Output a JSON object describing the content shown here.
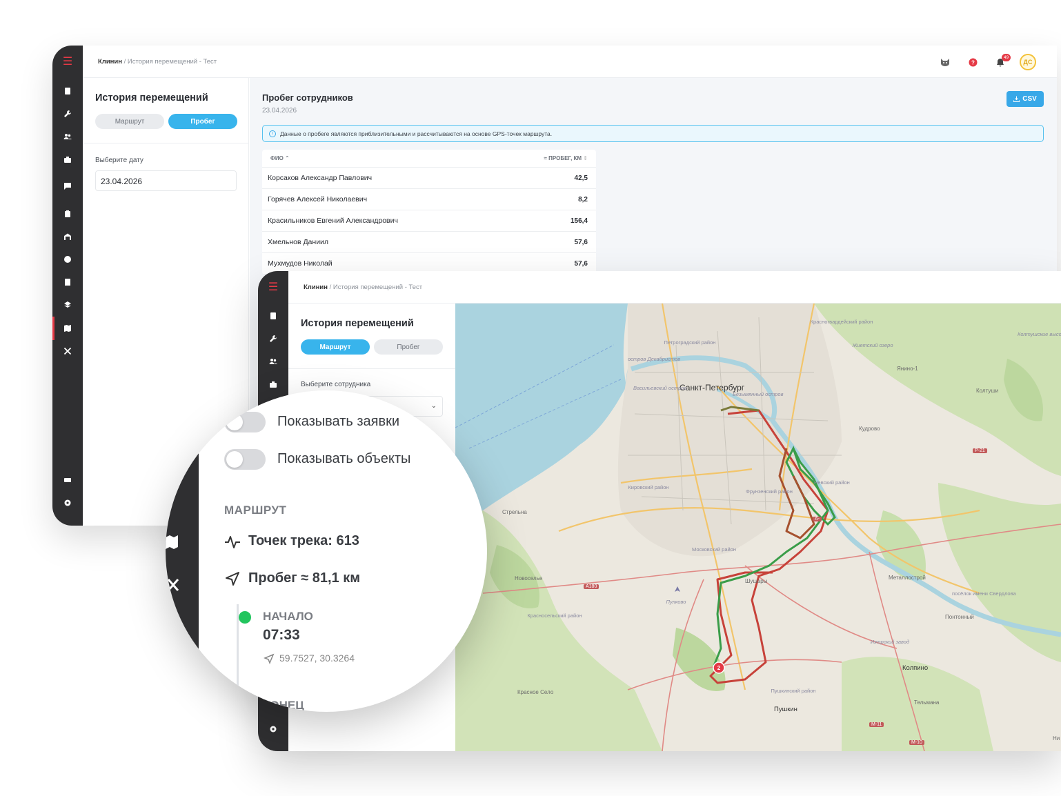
{
  "breadcrumb": {
    "company": "Клинин",
    "separator": "/",
    "page": "История перемещений - Тест"
  },
  "topbar": {
    "notifications_count": "49",
    "avatar_initials": "ДС"
  },
  "sidebar": {
    "items": [
      "list-icon",
      "wrench-icon",
      "users-icon",
      "briefcase-icon",
      "chat-icon",
      "clipboard-icon",
      "warehouse-icon",
      "chart-pie-icon",
      "report-icon",
      "map-layers-icon",
      "map-icon",
      "tools-icon",
      "card-icon",
      "settings-icon"
    ]
  },
  "history": {
    "title": "История перемещений",
    "tab_route": "Маршрут",
    "tab_mileage": "Пробег",
    "date_label": "Выберите дату",
    "date_value": "23.04.2026",
    "employee_label": "Выберите сотрудника"
  },
  "mileage": {
    "title": "Пробег сотрудников",
    "date": "23.04.2026",
    "csv_label": "CSV",
    "info": "Данные о пробеге являются приблизительными и рассчитываются на основе GPS-точек маршрута.",
    "col_name": "ФИО",
    "col_km": "≈ ПРОБЕГ, КМ",
    "rows": [
      {
        "name": "Корсаков Александр Павлович",
        "km": "42,5"
      },
      {
        "name": "Горячев Алексей Николаевич",
        "km": "8,2"
      },
      {
        "name": "Красильников Евгений Александрович",
        "km": "156,4"
      },
      {
        "name": "Хмельнов Даниил",
        "km": "57,6"
      },
      {
        "name": "Мухмудов Николай",
        "km": "57,6"
      }
    ]
  },
  "route_panel": {
    "show_requests": "Показывать заявки",
    "show_objects": "Показывать объекты",
    "section": "МАРШРУТ",
    "track_points": "Точек трека: 613",
    "distance": "Пробег ≈ 81,1 км",
    "start_label": "НАЧАЛО",
    "start_time": "07:33",
    "start_coords": "59.7527, 30.3264",
    "end_label": "КОНЕЦ"
  },
  "map": {
    "labels": {
      "spb": "Санкт-Петербург",
      "petrogradsky": "Петроградский район",
      "krasnogvard": "Красногвардейский район",
      "dekabr": "остров Декабристов",
      "vasil": "Васильевский остров",
      "bezym": "Безымянный остров",
      "kirov": "Кировский район",
      "frunze": "Фрунзенский район",
      "nevsky": "Невский район",
      "moskov": "Московский район",
      "strelna": "Стрельна",
      "novoselie": "Новоселье",
      "krasnosel": "Красносельский район",
      "shushary": "Шушары",
      "metallostroy": "Металлострой",
      "sverdlova": "посёлок имени Свердлова",
      "pontonny": "Понтонный",
      "izhorsky": "Ижорский завод",
      "kolpino": "Колпино",
      "krasnoe_selo": "Красное Село",
      "pushkinsky": "Пушкинский район",
      "pushkin": "Пушкин",
      "telmana": "Тельмана",
      "koltushi": "Колтуши",
      "kudrovo": "Кудрово",
      "yanino": "Янино-1",
      "zhiteskiy": "Жиетский озеро",
      "koltushskie": "Колтушские высоты",
      "pulkovo": "Пулково",
      "r21": "Р-21",
      "a180": "А180",
      "m11": "М-11",
      "m10": "М-10",
      "a": "А-",
      "ni": "Ни"
    },
    "marker": "2",
    "colors": {
      "route_red": "#c7423a",
      "route_green": "#3a9d49",
      "route_olive": "#7a7a3a",
      "water": "#aad3df",
      "land": "#ece8df",
      "green": "#c8dfae"
    }
  },
  "colors": {
    "accent": "#38b4ec",
    "danger": "#e53945",
    "sidebar": "#2f2f31",
    "start_dot": "#22c55e"
  }
}
